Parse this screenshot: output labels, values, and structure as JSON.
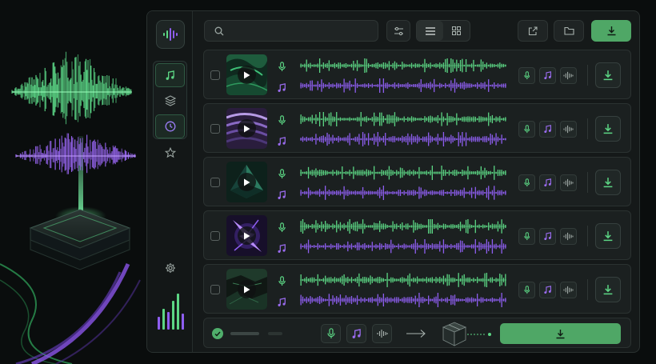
{
  "search": {
    "placeholder": "",
    "value": ""
  },
  "toolbar": {
    "icons": [
      "filter-icon",
      "list-view-icon",
      "grid-view-icon",
      "share-icon",
      "folder-icon",
      "download-icon"
    ],
    "active_view": "list"
  },
  "sidebar": {
    "items": [
      {
        "icon": "music-note-icon",
        "active": true
      },
      {
        "icon": "layers-icon",
        "active": false
      },
      {
        "icon": "clock-icon",
        "active": true
      },
      {
        "icon": "star-icon",
        "active": false
      },
      {
        "icon": "gear-icon",
        "active": false
      }
    ]
  },
  "tracks": [
    {
      "checked": false,
      "thumbnail": "green-marble"
    },
    {
      "checked": false,
      "thumbnail": "purple-waves"
    },
    {
      "checked": false,
      "thumbnail": "green-crystal"
    },
    {
      "checked": false,
      "thumbnail": "purple-lightning"
    },
    {
      "checked": false,
      "thumbnail": "green-rock"
    }
  ],
  "stems": [
    {
      "type": "vocals",
      "icon": "microphone-icon",
      "color": "#5cd684"
    },
    {
      "type": "music",
      "icon": "music-note-icon",
      "color": "#9b6cf0"
    }
  ],
  "bottom_bar": {
    "status": "complete",
    "icons": [
      "microphone-icon",
      "music-note-icon",
      "waveform-icon",
      "arrow-right-icon",
      "package-icon"
    ]
  },
  "colors": {
    "accent_green": "#4fa766",
    "wave_green": "#5cd684",
    "wave_purple": "#8e5ef0",
    "background": "#0a0d0d",
    "panel": "#151919"
  }
}
